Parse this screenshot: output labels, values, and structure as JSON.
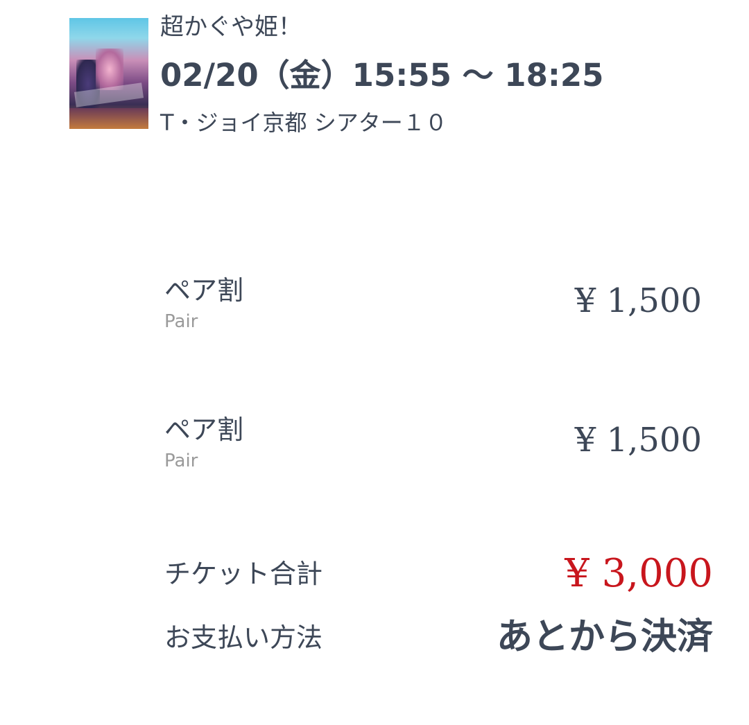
{
  "movie": {
    "title": "超かぐや姫！",
    "datetime": "02/20（金）15:55 〜 18:25",
    "theater": "T・ジョイ京都 シアター１０"
  },
  "tickets": [
    {
      "name": "ペア割",
      "sub": "Pair",
      "price": "¥ 1,500"
    },
    {
      "name": "ペア割",
      "sub": "Pair",
      "price": "¥ 1,500"
    }
  ],
  "summary": {
    "total_label": "チケット合計",
    "total_value": "¥ 3,000",
    "payment_label": "お支払い方法",
    "payment_value": "あとから決済"
  },
  "colors": {
    "text": "#3d4757",
    "subtext": "#9a9a9a",
    "total": "#c8161d"
  }
}
